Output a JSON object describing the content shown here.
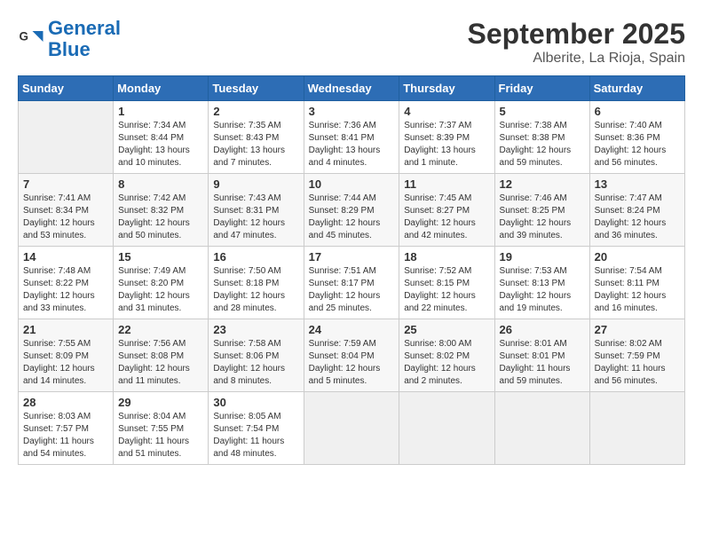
{
  "header": {
    "logo_general": "General",
    "logo_blue": "Blue",
    "month_year": "September 2025",
    "location": "Alberite, La Rioja, Spain"
  },
  "days_of_week": [
    "Sunday",
    "Monday",
    "Tuesday",
    "Wednesday",
    "Thursday",
    "Friday",
    "Saturday"
  ],
  "weeks": [
    [
      {
        "day": "",
        "detail": ""
      },
      {
        "day": "1",
        "detail": "Sunrise: 7:34 AM\nSunset: 8:44 PM\nDaylight: 13 hours\nand 10 minutes."
      },
      {
        "day": "2",
        "detail": "Sunrise: 7:35 AM\nSunset: 8:43 PM\nDaylight: 13 hours\nand 7 minutes."
      },
      {
        "day": "3",
        "detail": "Sunrise: 7:36 AM\nSunset: 8:41 PM\nDaylight: 13 hours\nand 4 minutes."
      },
      {
        "day": "4",
        "detail": "Sunrise: 7:37 AM\nSunset: 8:39 PM\nDaylight: 13 hours\nand 1 minute."
      },
      {
        "day": "5",
        "detail": "Sunrise: 7:38 AM\nSunset: 8:38 PM\nDaylight: 12 hours\nand 59 minutes."
      },
      {
        "day": "6",
        "detail": "Sunrise: 7:40 AM\nSunset: 8:36 PM\nDaylight: 12 hours\nand 56 minutes."
      }
    ],
    [
      {
        "day": "7",
        "detail": "Sunrise: 7:41 AM\nSunset: 8:34 PM\nDaylight: 12 hours\nand 53 minutes."
      },
      {
        "day": "8",
        "detail": "Sunrise: 7:42 AM\nSunset: 8:32 PM\nDaylight: 12 hours\nand 50 minutes."
      },
      {
        "day": "9",
        "detail": "Sunrise: 7:43 AM\nSunset: 8:31 PM\nDaylight: 12 hours\nand 47 minutes."
      },
      {
        "day": "10",
        "detail": "Sunrise: 7:44 AM\nSunset: 8:29 PM\nDaylight: 12 hours\nand 45 minutes."
      },
      {
        "day": "11",
        "detail": "Sunrise: 7:45 AM\nSunset: 8:27 PM\nDaylight: 12 hours\nand 42 minutes."
      },
      {
        "day": "12",
        "detail": "Sunrise: 7:46 AM\nSunset: 8:25 PM\nDaylight: 12 hours\nand 39 minutes."
      },
      {
        "day": "13",
        "detail": "Sunrise: 7:47 AM\nSunset: 8:24 PM\nDaylight: 12 hours\nand 36 minutes."
      }
    ],
    [
      {
        "day": "14",
        "detail": "Sunrise: 7:48 AM\nSunset: 8:22 PM\nDaylight: 12 hours\nand 33 minutes."
      },
      {
        "day": "15",
        "detail": "Sunrise: 7:49 AM\nSunset: 8:20 PM\nDaylight: 12 hours\nand 31 minutes."
      },
      {
        "day": "16",
        "detail": "Sunrise: 7:50 AM\nSunset: 8:18 PM\nDaylight: 12 hours\nand 28 minutes."
      },
      {
        "day": "17",
        "detail": "Sunrise: 7:51 AM\nSunset: 8:17 PM\nDaylight: 12 hours\nand 25 minutes."
      },
      {
        "day": "18",
        "detail": "Sunrise: 7:52 AM\nSunset: 8:15 PM\nDaylight: 12 hours\nand 22 minutes."
      },
      {
        "day": "19",
        "detail": "Sunrise: 7:53 AM\nSunset: 8:13 PM\nDaylight: 12 hours\nand 19 minutes."
      },
      {
        "day": "20",
        "detail": "Sunrise: 7:54 AM\nSunset: 8:11 PM\nDaylight: 12 hours\nand 16 minutes."
      }
    ],
    [
      {
        "day": "21",
        "detail": "Sunrise: 7:55 AM\nSunset: 8:09 PM\nDaylight: 12 hours\nand 14 minutes."
      },
      {
        "day": "22",
        "detail": "Sunrise: 7:56 AM\nSunset: 8:08 PM\nDaylight: 12 hours\nand 11 minutes."
      },
      {
        "day": "23",
        "detail": "Sunrise: 7:58 AM\nSunset: 8:06 PM\nDaylight: 12 hours\nand 8 minutes."
      },
      {
        "day": "24",
        "detail": "Sunrise: 7:59 AM\nSunset: 8:04 PM\nDaylight: 12 hours\nand 5 minutes."
      },
      {
        "day": "25",
        "detail": "Sunrise: 8:00 AM\nSunset: 8:02 PM\nDaylight: 12 hours\nand 2 minutes."
      },
      {
        "day": "26",
        "detail": "Sunrise: 8:01 AM\nSunset: 8:01 PM\nDaylight: 11 hours\nand 59 minutes."
      },
      {
        "day": "27",
        "detail": "Sunrise: 8:02 AM\nSunset: 7:59 PM\nDaylight: 11 hours\nand 56 minutes."
      }
    ],
    [
      {
        "day": "28",
        "detail": "Sunrise: 8:03 AM\nSunset: 7:57 PM\nDaylight: 11 hours\nand 54 minutes."
      },
      {
        "day": "29",
        "detail": "Sunrise: 8:04 AM\nSunset: 7:55 PM\nDaylight: 11 hours\nand 51 minutes."
      },
      {
        "day": "30",
        "detail": "Sunrise: 8:05 AM\nSunset: 7:54 PM\nDaylight: 11 hours\nand 48 minutes."
      },
      {
        "day": "",
        "detail": ""
      },
      {
        "day": "",
        "detail": ""
      },
      {
        "day": "",
        "detail": ""
      },
      {
        "day": "",
        "detail": ""
      }
    ]
  ]
}
